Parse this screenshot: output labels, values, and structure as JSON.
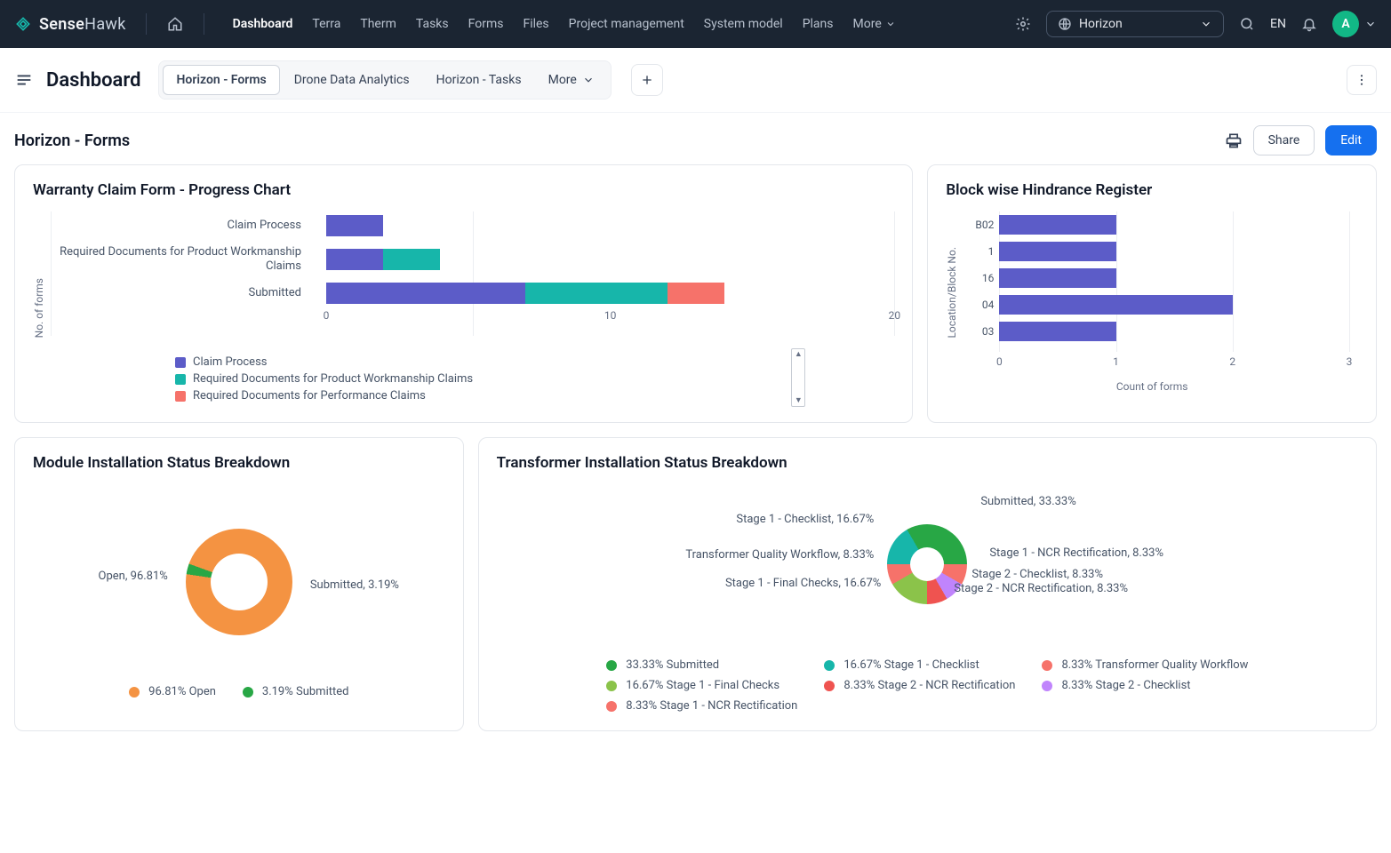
{
  "brand": {
    "sense": "Sense",
    "hawk": "Hawk"
  },
  "nav": {
    "items": [
      "Dashboard",
      "Terra",
      "Therm",
      "Tasks",
      "Forms",
      "Files",
      "Project management",
      "System model",
      "Plans"
    ],
    "more": "More",
    "selector_label": "Horizon",
    "lang": "EN",
    "avatar_initial": "A"
  },
  "subbar": {
    "title": "Dashboard",
    "tabs": [
      "Horizon - Forms",
      "Drone Data Analytics",
      "Horizon - Tasks"
    ],
    "more": "More"
  },
  "titlebar": {
    "heading": "Horizon - Forms",
    "share": "Share",
    "edit": "Edit"
  },
  "cards": {
    "warranty": {
      "title": "Warranty Claim Form - Progress Chart"
    },
    "block": {
      "title": "Block wise Hindrance Register"
    },
    "module": {
      "title": "Module Installation Status Breakdown"
    },
    "transformer": {
      "title": "Transformer Installation Status Breakdown"
    }
  },
  "chart_data": [
    {
      "id": "warranty",
      "type": "bar",
      "orientation": "horizontal",
      "stacked": true,
      "ylabel": "No. of forms",
      "xlim": [
        0,
        20
      ],
      "xticks": [
        0,
        10,
        20
      ],
      "categories": [
        "Claim Process",
        "Required Documents for Product Workmanship Claims",
        "Submitted"
      ],
      "series": [
        {
          "name": "Claim Process",
          "color": "#5c5cc8",
          "values": [
            2,
            2,
            7
          ]
        },
        {
          "name": "Required Documents for Product Workmanship Claims",
          "color": "#17b6aa",
          "values": [
            0,
            2,
            5
          ]
        },
        {
          "name": "Required Documents for Performance Claims",
          "color": "#f6726a",
          "values": [
            0,
            0,
            2
          ]
        }
      ]
    },
    {
      "id": "block",
      "type": "bar",
      "orientation": "horizontal",
      "xlabel": "Count of forms",
      "ylabel": "Location/Block No.",
      "xlim": [
        0,
        3
      ],
      "xticks": [
        0,
        1,
        2,
        3
      ],
      "categories": [
        "B02",
        "1",
        "16",
        "04",
        "03"
      ],
      "series": [
        {
          "name": "Count of forms",
          "color": "#5c5cc8",
          "values": [
            1,
            1,
            1,
            2,
            1
          ]
        }
      ]
    },
    {
      "id": "module",
      "type": "pie",
      "donut": true,
      "series": [
        {
          "name": "Open",
          "value": 96.81,
          "color": "#f49342",
          "label": "Open, 96.81%"
        },
        {
          "name": "Submitted",
          "value": 3.19,
          "color": "#28a745",
          "label": "Submitted, 3.19%"
        }
      ],
      "legend": [
        "96.81% Open",
        "3.19% Submitted"
      ]
    },
    {
      "id": "transformer",
      "type": "pie",
      "donut": true,
      "series": [
        {
          "name": "Submitted",
          "value": 33.33,
          "color": "#28a745",
          "label": "Submitted, 33.33%"
        },
        {
          "name": "Stage 1 - Checklist",
          "value": 16.67,
          "color": "#17b6aa",
          "label": "Stage 1 - Checklist, 16.67%"
        },
        {
          "name": "Transformer Quality Workflow",
          "value": 8.33,
          "color": "#f6726a",
          "label": "Transformer Quality Workflow, 8.33%"
        },
        {
          "name": "Stage 1 - Final Checks",
          "value": 16.67,
          "color": "#8bc34a",
          "label": "Stage 1 - Final Checks, 16.67%"
        },
        {
          "name": "Stage 2 - NCR Rectification",
          "value": 8.33,
          "color": "#ef5350",
          "label": "Stage 2 - NCR Rectification, 8.33%"
        },
        {
          "name": "Stage 2 - Checklist",
          "value": 8.33,
          "color": "#c084fc",
          "label": "Stage 2 - Checklist, 8.33%"
        },
        {
          "name": "Stage 1 - NCR Rectification",
          "value": 8.33,
          "color": "#f6726a",
          "label": "Stage 1 - NCR Rectification, 8.33%"
        }
      ],
      "legend": [
        "33.33% Submitted",
        "16.67% Stage 1 - Checklist",
        "8.33% Transformer Quality Workflow",
        "16.67% Stage 1 - Final Checks",
        "8.33% Stage 2 - NCR Rectification",
        "8.33% Stage 2 - Checklist",
        "8.33% Stage 1 - NCR Rectification"
      ]
    }
  ]
}
